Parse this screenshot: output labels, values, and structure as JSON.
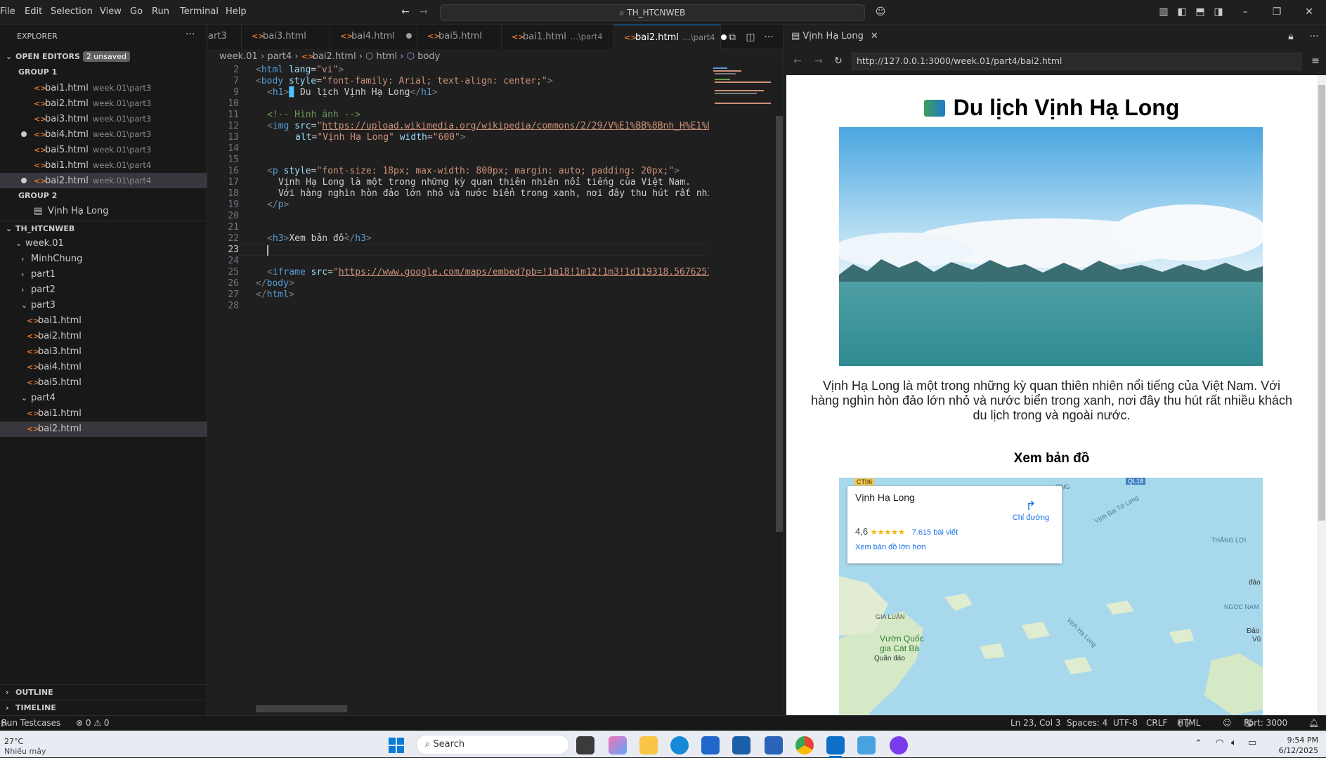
{
  "titlebar": {
    "menus": [
      "File",
      "Edit",
      "Selection",
      "View",
      "Go",
      "Run",
      "Terminal",
      "Help"
    ],
    "search": "TH_HTCNWEB"
  },
  "sidebar": {
    "title": "EXPLORER",
    "open_editors_label": "OPEN EDITORS",
    "unsaved_badge": "2 unsaved",
    "group1_label": "GROUP 1",
    "group1": [
      {
        "name": "bai1.html",
        "path": "week.01\\part3"
      },
      {
        "name": "bai2.html",
        "path": "week.01\\part3"
      },
      {
        "name": "bai3.html",
        "path": "week.01\\part3"
      },
      {
        "name": "bai4.html",
        "path": "week.01\\part3"
      },
      {
        "name": "bai5.html",
        "path": "week.01\\part3"
      },
      {
        "name": "bai1.html",
        "path": "week.01\\part4"
      },
      {
        "name": "bai2.html",
        "path": "week.01\\part4"
      }
    ],
    "group2_label": "GROUP 2",
    "group2_item": "Vịnh Hạ Long",
    "root_label": "TH_HTCNWEB",
    "tree": {
      "week": "week.01",
      "minhchung": "MinhChung",
      "part1": "part1",
      "part2": "part2",
      "part3": "part3",
      "part3_files": [
        "bai1.html",
        "bai2.html",
        "bai3.html",
        "bai4.html",
        "bai5.html"
      ],
      "part4": "part4",
      "part4_files": [
        "bai1.html",
        "bai2.html"
      ]
    },
    "outline": "OUTLINE",
    "timeline": "TIMELINE"
  },
  "tabs": [
    {
      "label": "art3"
    },
    {
      "label": "bai3.html"
    },
    {
      "label": "bai4.html"
    },
    {
      "label": "bai5.html"
    },
    {
      "label": "bai1.html",
      "sub": "...\\part4"
    },
    {
      "label": "bai2.html",
      "sub": "...\\part4"
    }
  ],
  "breadcrumb": [
    "week.01",
    "part4",
    "bai2.html",
    "html",
    "body"
  ],
  "code_lines": [
    "2",
    "7",
    "9",
    "10",
    "11",
    "12",
    "13",
    "14",
    "15",
    "16",
    "17",
    "18",
    "19",
    "20",
    "21",
    "22",
    "23",
    "24",
    "25",
    "26",
    "27",
    "28"
  ],
  "browser": {
    "tab_label": "Vịnh Hạ Long",
    "url": "http://127.0.0.1:3000/week.01/part4/bai2.html",
    "h1": "Du lịch Vịnh Hạ Long",
    "paragraph": "Vịnh Hạ Long là một trong những kỳ quan thiên nhiên nổi tiếng của Việt Nam. Với hàng nghìn hòn đảo lớn nhỏ và nước biển trong xanh, nơi đây thu hút rất nhiều khách du lịch trong và ngoài nước.",
    "h3": "Xem bản đồ",
    "map": {
      "place": "Vịnh Hạ Long",
      "directions": "Chỉ đường",
      "rating": "4,6",
      "stars": "★★★★★",
      "reviews": "7.615 bài viết",
      "larger_map": "Xem bản đồ lớn hơn",
      "labels": [
        "CT06",
        "QL18",
        "Vịnh Bái Tử Long",
        "THẮNG LỢI",
        "đảo",
        "NGỌC NAM",
        "Đảo",
        "Vũ",
        "GIA LUẬN",
        "Vườn Quốc",
        "gia Cát Bà",
        "Quần đảo",
        "Vịnh Hạ Long",
        "ONG"
      ]
    }
  },
  "statusbar": {
    "run": "Run Testcases",
    "problems": "⊗ 0 ⚠ 0",
    "position": "Ln 23, Col 3",
    "spaces": "Spaces: 4",
    "encoding": "UTF-8",
    "eol": "CRLF",
    "lang": "HTML",
    "port": "Port: 3000"
  },
  "taskbar": {
    "weather_temp": "27°C",
    "weather_text": "Nhiều mây",
    "search": "Search",
    "time": "9:54 PM",
    "date": "6/12/2025"
  }
}
